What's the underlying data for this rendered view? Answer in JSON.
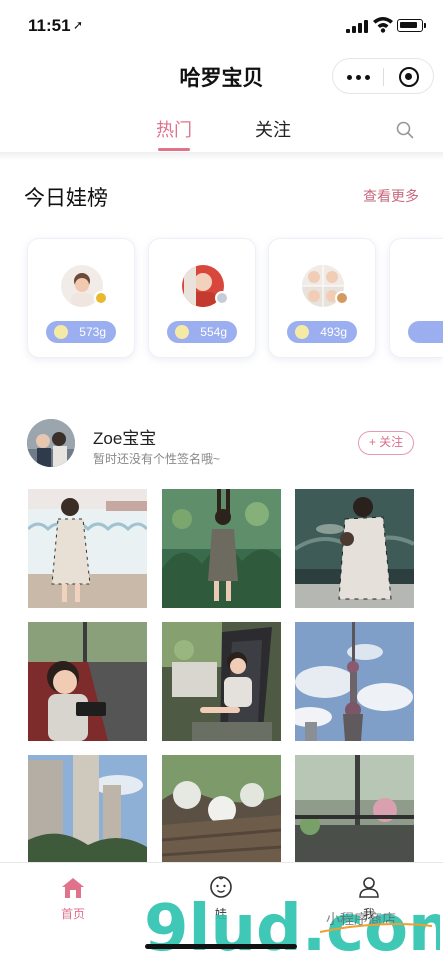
{
  "status_bar": {
    "time": "11:51"
  },
  "app": {
    "title": "哈罗宝贝"
  },
  "tabs": [
    {
      "label": "热门",
      "active": true
    },
    {
      "label": "关注",
      "active": false
    }
  ],
  "ranking": {
    "title": "今日娃榜",
    "more_label": "查看更多",
    "items": [
      {
        "score": "573g"
      },
      {
        "score": "554g"
      },
      {
        "score": "493g"
      }
    ]
  },
  "post": {
    "user_name": "Zoe宝宝",
    "signature": "暂时还没有个性签名哦~",
    "follow_label": "+ 关注"
  },
  "tabbar": {
    "items": [
      {
        "label": "首页",
        "active": true
      },
      {
        "label": "娃",
        "active": false
      },
      {
        "label": "我",
        "active": false
      }
    ]
  },
  "watermark": {
    "text": "9lud.com",
    "sub": "小程序商店"
  },
  "colors": {
    "accent": "#e0728c",
    "score_bg": "#9aaef0",
    "more": "#c9687e"
  }
}
